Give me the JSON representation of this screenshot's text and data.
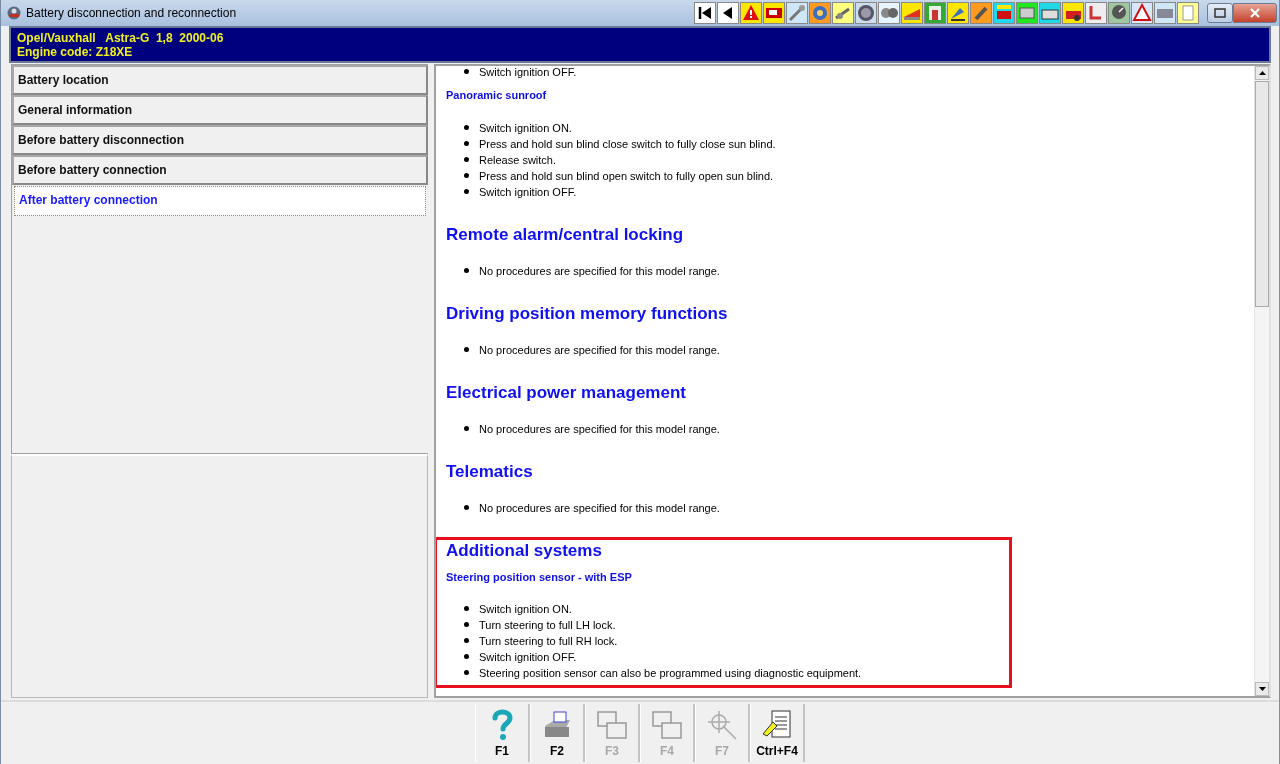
{
  "window": {
    "title": "Battery disconnection and reconnection"
  },
  "vehicle": {
    "line_1": "Opel/Vauxhall   Astra-G  1,8  2000-06",
    "line_2": "Engine code: Z18XE"
  },
  "menu": [
    {
      "label": "Battery location",
      "selected": false
    },
    {
      "label": "General information",
      "selected": false
    },
    {
      "label": "Before battery disconnection",
      "selected": false
    },
    {
      "label": "Before battery connection",
      "selected": false
    },
    {
      "label": "After battery connection",
      "selected": true
    }
  ],
  "document": {
    "sections": [
      {
        "highlighted": false,
        "blocks": [
          {
            "kind": "bullets",
            "items": [
              "Switch ignition OFF."
            ]
          },
          {
            "kind": "subheading",
            "text": "Panoramic sunroof"
          },
          {
            "kind": "bullets",
            "items": [
              "Switch ignition ON.",
              "Press and hold sun blind close switch to fully close sun blind.",
              "Release switch.",
              "Press and hold sun blind open switch to fully open sun blind.",
              "Switch ignition OFF."
            ]
          }
        ]
      },
      {
        "highlighted": false,
        "blocks": [
          {
            "kind": "heading",
            "text": "Remote alarm/central locking"
          },
          {
            "kind": "bullets",
            "items": [
              "No procedures are specified for this model range."
            ]
          }
        ]
      },
      {
        "highlighted": false,
        "blocks": [
          {
            "kind": "heading",
            "text": "Driving position memory functions"
          },
          {
            "kind": "bullets",
            "items": [
              "No procedures are specified for this model range."
            ]
          }
        ]
      },
      {
        "highlighted": false,
        "blocks": [
          {
            "kind": "heading",
            "text": "Electrical power management"
          },
          {
            "kind": "bullets",
            "items": [
              "No procedures are specified for this model range."
            ]
          }
        ]
      },
      {
        "highlighted": false,
        "blocks": [
          {
            "kind": "heading",
            "text": "Telematics"
          },
          {
            "kind": "bullets",
            "items": [
              "No procedures are specified for this model range."
            ]
          }
        ]
      },
      {
        "highlighted": true,
        "blocks": [
          {
            "kind": "heading",
            "text": "Additional systems"
          },
          {
            "kind": "subheading",
            "text": "Steering position sensor - with ESP"
          },
          {
            "kind": "bullets",
            "items": [
              "Switch ignition ON.",
              "Turn steering to full LH lock.",
              "Turn steering to full RH lock.",
              "Switch ignition OFF.",
              "Steering position sensor can also be programmed using diagnostic equipment."
            ]
          }
        ]
      }
    ]
  },
  "function_keys": [
    {
      "label": "F1",
      "kind": "help",
      "disabled": false
    },
    {
      "label": "F2",
      "kind": "print",
      "disabled": false
    },
    {
      "label": "F3",
      "kind": "pictures",
      "disabled": true
    },
    {
      "label": "F4",
      "kind": "pictures",
      "disabled": true
    },
    {
      "label": "F7",
      "kind": "crosshair",
      "disabled": true
    },
    {
      "label": "Ctrl+F4",
      "kind": "notes",
      "disabled": false
    }
  ]
}
